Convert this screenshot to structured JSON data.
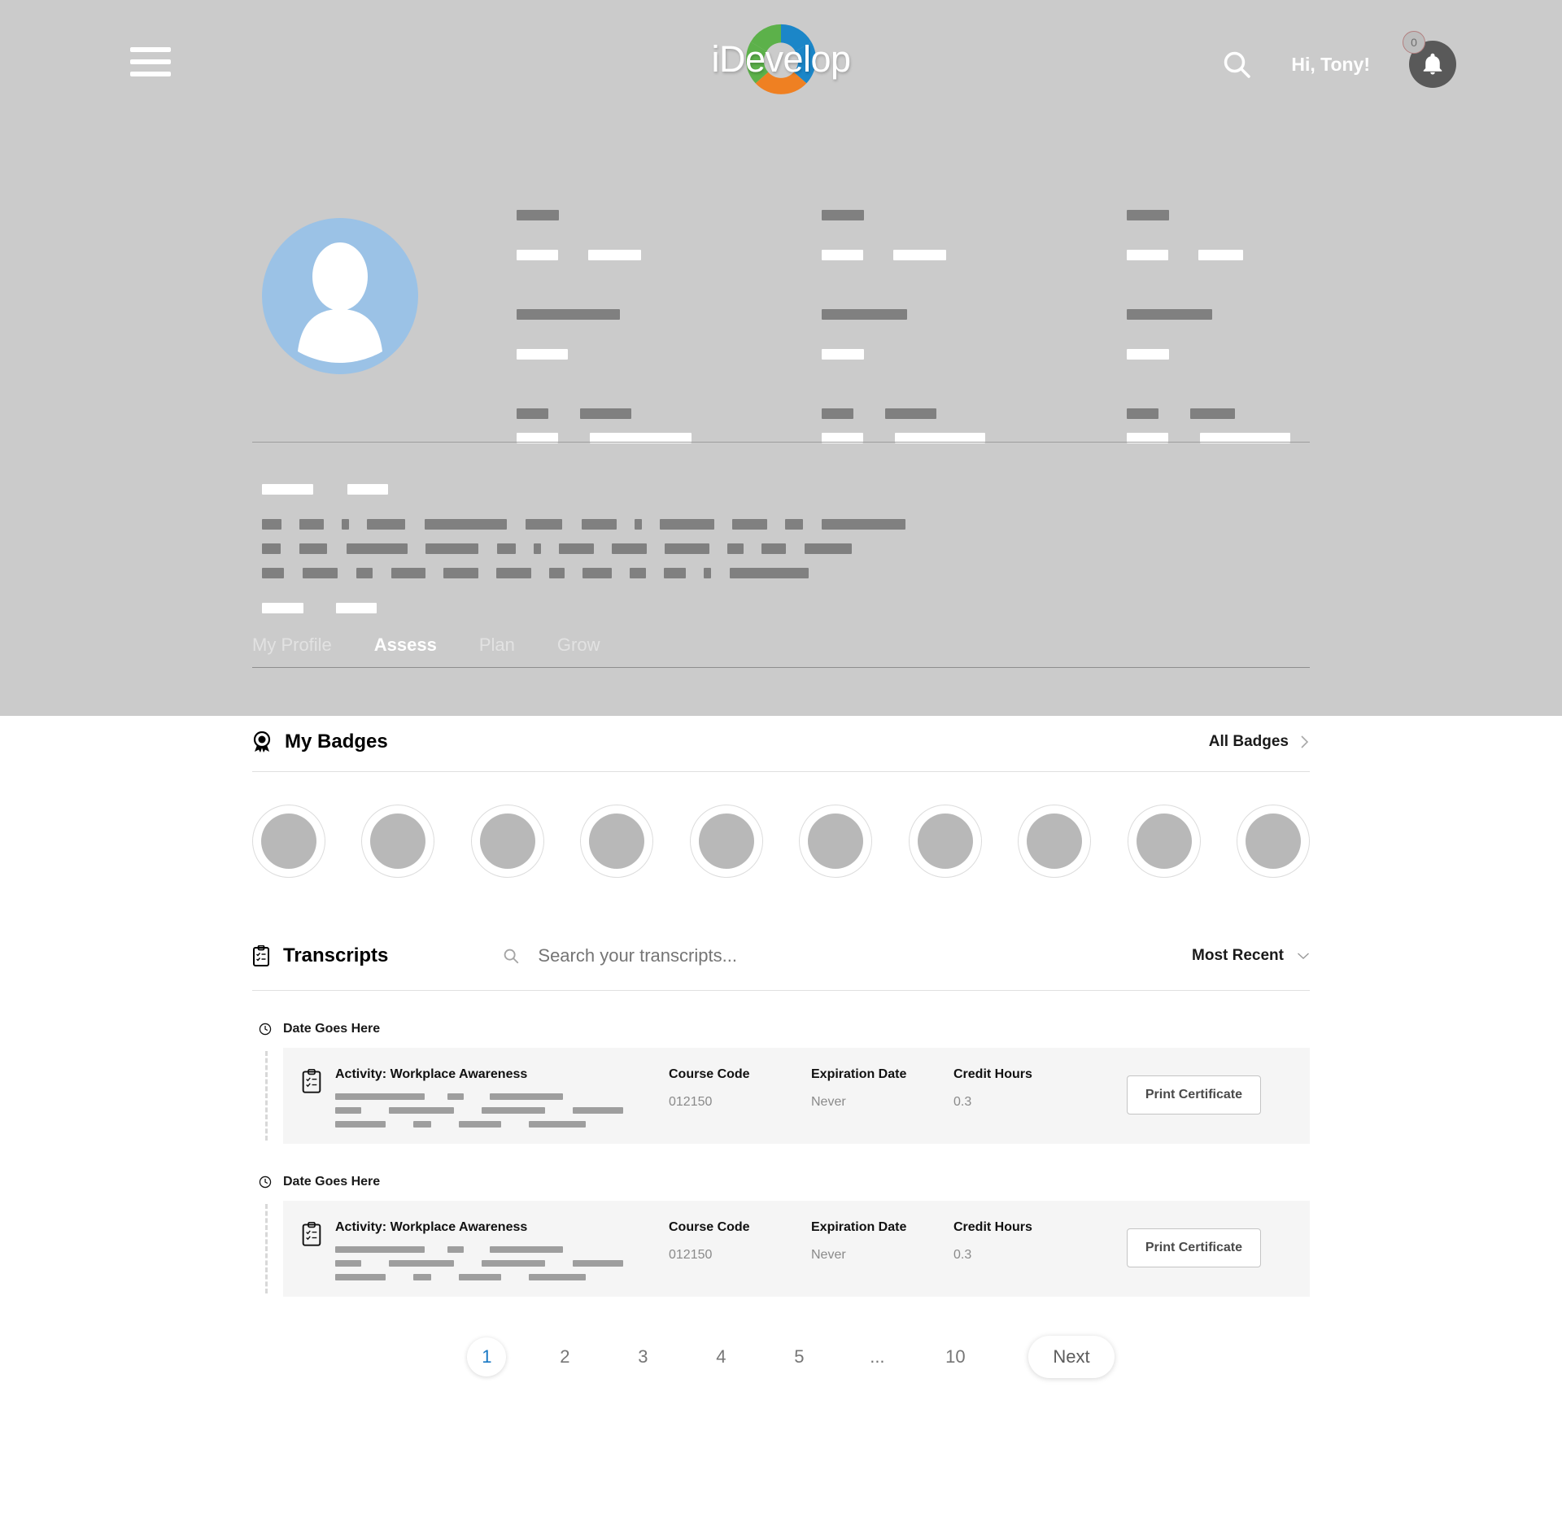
{
  "header": {
    "menu_icon": "hamburger-menu-icon",
    "logo_text": "iDevelop",
    "logo_colors": {
      "green": "#5cb14a",
      "blue": "#1b86c8",
      "orange": "#ef8022"
    },
    "search_icon": "search-icon",
    "greeting": "Hi, Tony!",
    "bell_icon": "notification-bell-icon",
    "notification_count": "0",
    "bell_bg": "#595959",
    "hero_bg": "#cbcbcb"
  },
  "profile": {
    "avatar_icon": "user-avatar-icon",
    "avatar_bg": "#9bc2e6",
    "skeleton_dark": "#808080",
    "skeleton_light": "#ffffff"
  },
  "tabs": [
    {
      "label": "My Profile",
      "active": false
    },
    {
      "label": "Assess",
      "active": true
    },
    {
      "label": "Plan",
      "active": false
    },
    {
      "label": "Grow",
      "active": false
    }
  ],
  "badges_section": {
    "icon": "award-ribbon-icon",
    "title": "My Badges",
    "all_link": "All Badges",
    "chevron_icon": "chevron-right-icon",
    "badge_count": 10,
    "badge_fill": "#b8b8b8"
  },
  "transcripts_section": {
    "icon": "clipboard-checklist-icon",
    "title": "Transcripts",
    "search_icon": "search-icon",
    "search_placeholder": "Search your transcripts...",
    "search_value": "",
    "sort_label": "Most Recent",
    "sort_chevron_icon": "chevron-down-icon",
    "groups": [
      {
        "date_icon": "clock-icon",
        "date_label": "Date Goes Here",
        "card": {
          "icon": "clipboard-checklist-icon",
          "activity_label": "Activity:",
          "activity_name": "Workplace Awareness",
          "course_code_header": "Course Code",
          "course_code_value": "012150",
          "expiration_header": "Expiration Date",
          "expiration_value": "Never",
          "credit_hours_header": "Credit Hours",
          "credit_hours_value": "0.3",
          "print_button": "Print Certificate"
        }
      },
      {
        "date_icon": "clock-icon",
        "date_label": "Date Goes Here",
        "card": {
          "icon": "clipboard-checklist-icon",
          "activity_label": "Activity:",
          "activity_name": "Workplace Awareness",
          "course_code_header": "Course Code",
          "course_code_value": "012150",
          "expiration_header": "Expiration Date",
          "expiration_value": "Never",
          "credit_hours_header": "Credit Hours",
          "credit_hours_value": "0.3",
          "print_button": "Print Certificate"
        }
      }
    ]
  },
  "pagination": {
    "pages": [
      "1",
      "2",
      "3",
      "4",
      "5",
      "...",
      "10"
    ],
    "current": "1",
    "next_label": "Next",
    "active_color": "#1878c4"
  }
}
